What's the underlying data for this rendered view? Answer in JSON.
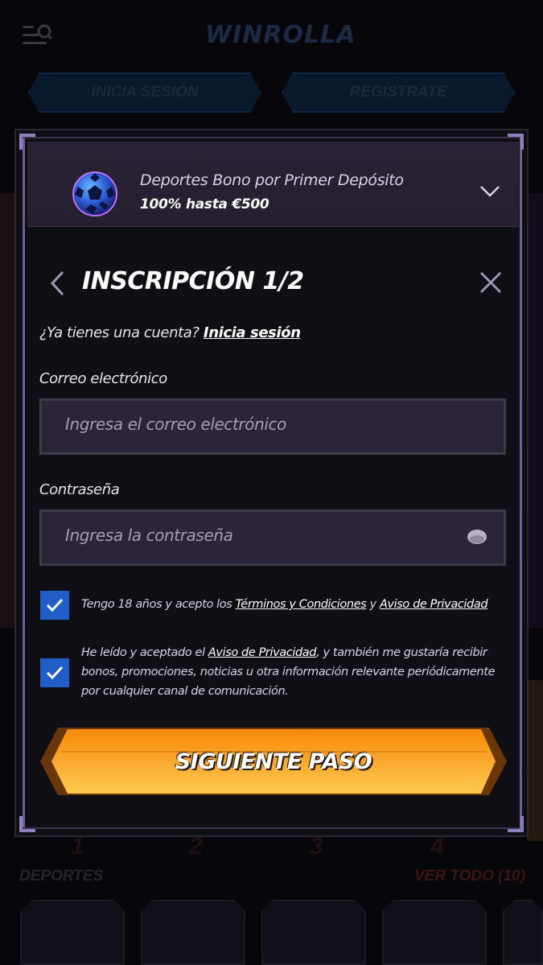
{
  "background": {
    "logo": "WINROLLA",
    "login_button": "INICIA SESIÓN",
    "register_button": "REGÍSTRATE",
    "section_label": "DEPORTES",
    "see_all": "VER TODO (10)",
    "numbers": [
      "1",
      "2",
      "3",
      "4"
    ]
  },
  "promo": {
    "title": "Deportes Bono por Primer Depósito",
    "subtitle": "100% hasta €500"
  },
  "form": {
    "title": "INSCRIPCIÓN 1/2",
    "have_account": "¿Ya tienes una cuenta?",
    "login_link": "Inicia sesión",
    "email_label": "Correo electrónico",
    "email_placeholder": "Ingresa el correo electrónico",
    "email_value": "",
    "password_label": "Contraseña",
    "password_placeholder": "Ingresa la contraseña",
    "password_value": "",
    "terms": {
      "checked": true,
      "text_before": "Tengo 18 años y acepto los ",
      "link1": "Términos y Condiciones",
      "text_mid": " y ",
      "link2": "Aviso de Privacidad"
    },
    "marketing": {
      "checked": true,
      "text_before": "He leído y aceptado el ",
      "link": "Aviso de Privacidad",
      "text_after": ", y también me gustaría recibir bonos, promociones, noticias u otra información relevante periódicamente por cualquier canal de comunicación."
    },
    "submit": "SIGUIENTE PASO"
  },
  "colors": {
    "accent_blue": "#1f5fc7",
    "cta_orange": "#f7a21c",
    "frame_purple": "#6f6196"
  },
  "icons": [
    "menu-search-icon",
    "soccer-ball-icon",
    "chevron-down-icon",
    "chevron-left-icon",
    "close-icon",
    "eye-icon",
    "checkmark-icon"
  ]
}
